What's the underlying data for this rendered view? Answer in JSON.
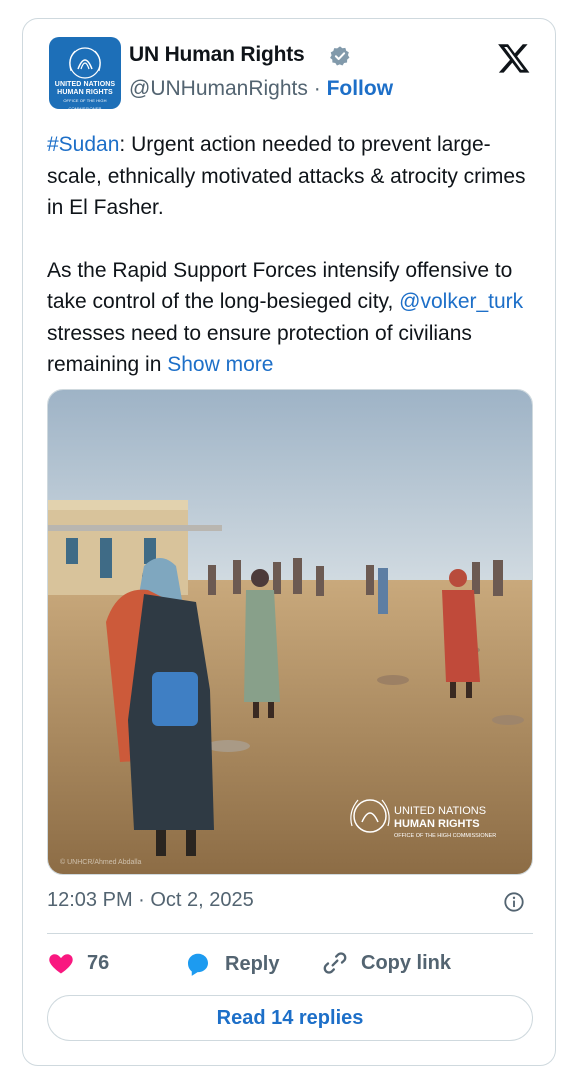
{
  "account": {
    "name": "UN Human Rights",
    "handle": "@UNHumanRights",
    "separator": "·",
    "follow_label": "Follow",
    "avatar_text_1": "UNITED NATIONS",
    "avatar_text_2": "HUMAN RIGHTS",
    "avatar_text_3": "OFFICE OF THE HIGH COMMISSIONER"
  },
  "tweet": {
    "hashtag": "#Sudan",
    "para1_rest": ": Urgent action needed to prevent large-scale, ethnically motivated attacks & atrocity crimes in El Fasher.",
    "para2_start": "As the Rapid Support Forces intensify offensive to take control of the long-besieged city, ",
    "mention": "@volker_turk",
    "para2_end": " stresses need to ensure protection of civilians remaining in ",
    "show_more": "Show more"
  },
  "media": {
    "watermark_line1": "UNITED NATIONS",
    "watermark_line2": "HUMAN RIGHTS",
    "watermark_line3": "OFFICE OF THE HIGH COMMISSIONER",
    "photo_credit": "© UNHCR/Ahmed Abdalla"
  },
  "meta": {
    "timestamp": "12:03 PM · Oct 2, 2025"
  },
  "actions": {
    "likes": "76",
    "reply_label": "Reply",
    "copy_label": "Copy link",
    "read_replies_label": "Read 14 replies"
  },
  "colors": {
    "accent": "#1d6fc8",
    "heart": "#f91880",
    "muted": "#536471",
    "border": "#cfd9de"
  },
  "icons": [
    "verified-icon",
    "x-logo-icon",
    "info-icon",
    "heart-icon",
    "reply-icon",
    "link-icon"
  ]
}
